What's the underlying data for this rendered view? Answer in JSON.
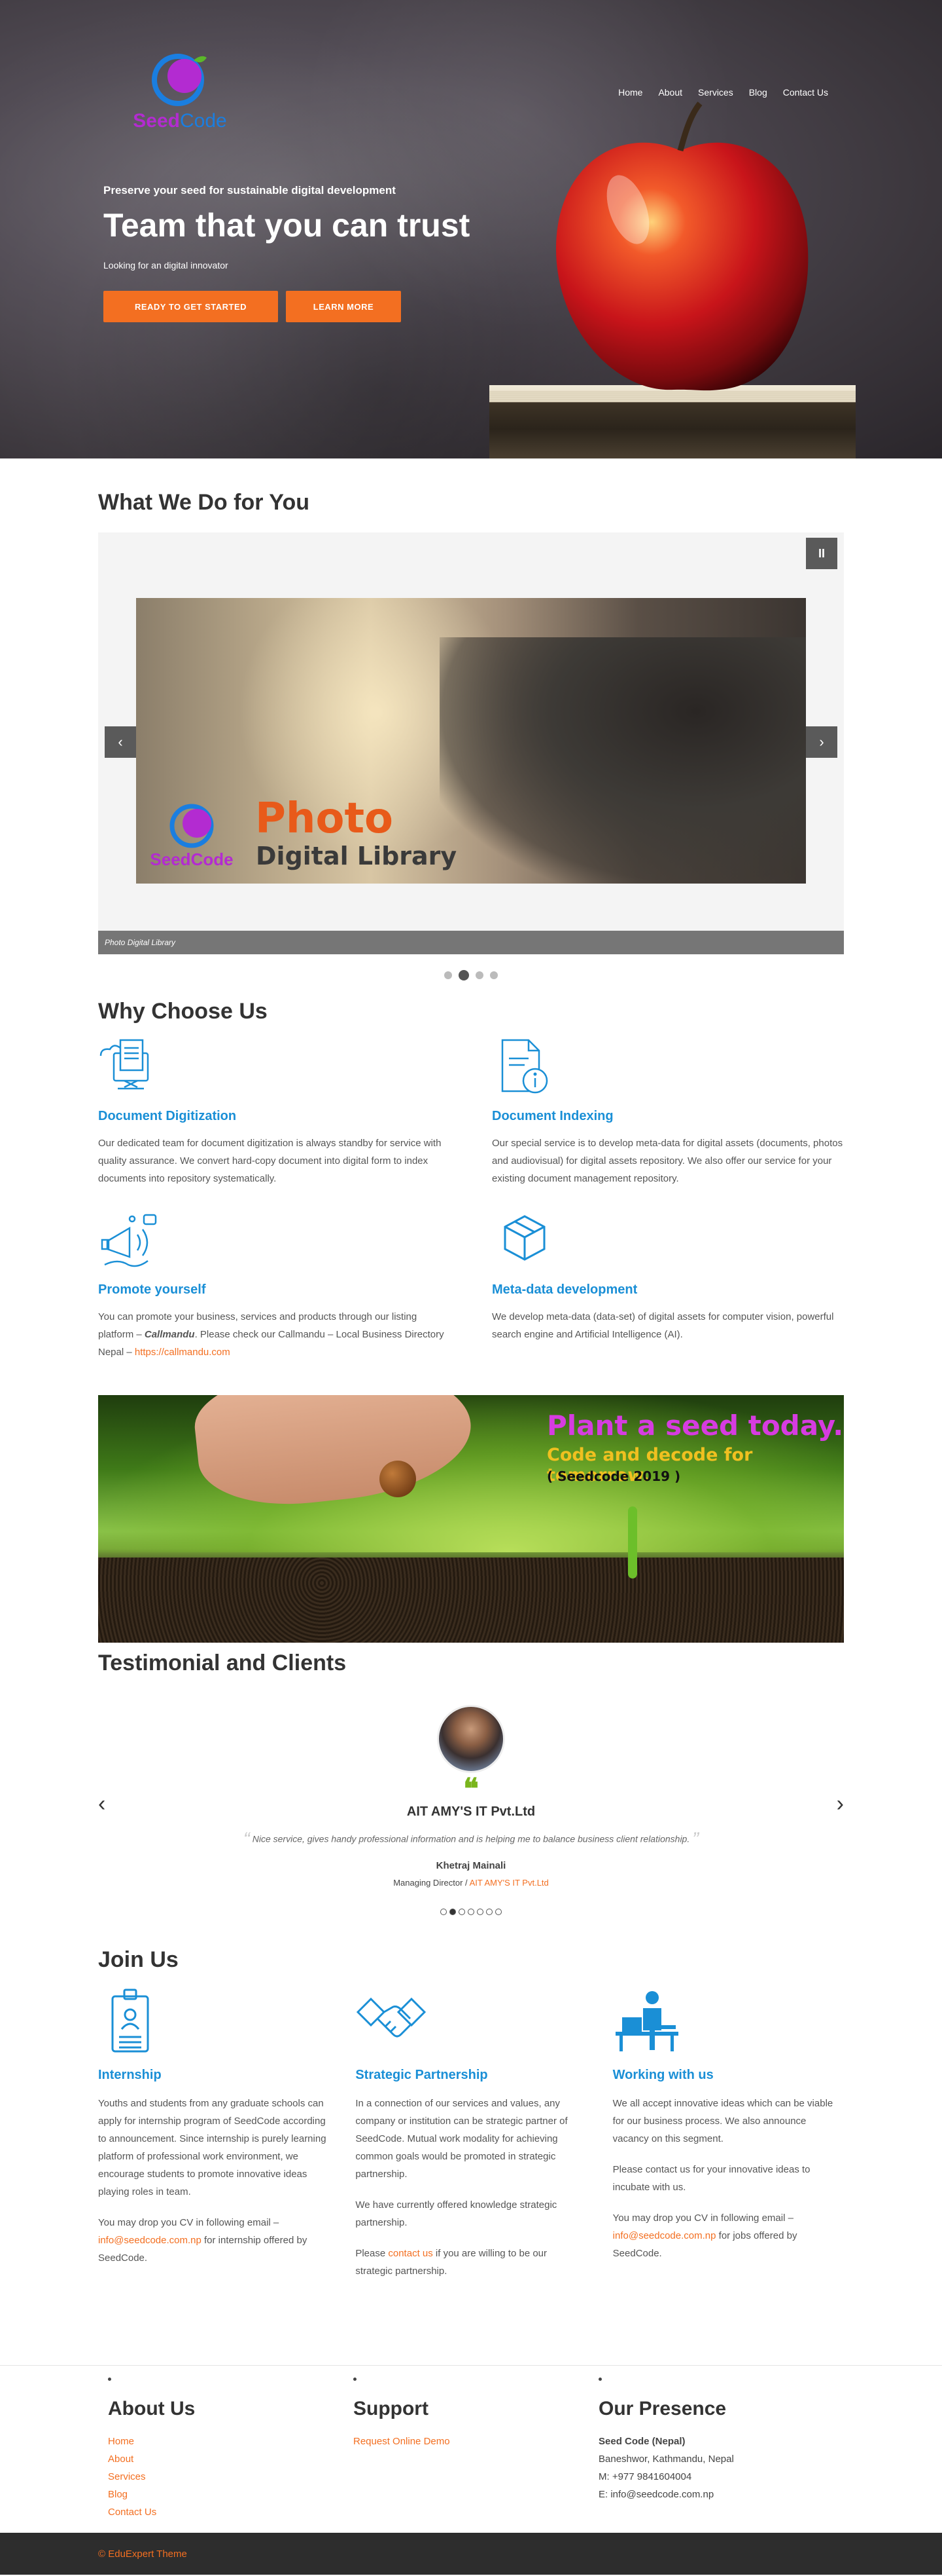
{
  "brand": {
    "logo_text_1": "Seed",
    "logo_text_2": "Code"
  },
  "nav": [
    "Home",
    "About",
    "Services",
    "Blog",
    "Contact Us"
  ],
  "hero": {
    "tagline": "Preserve your seed for sustainable digital development",
    "title": "Team that you can trust",
    "subtitle": "Looking for an digital innovator",
    "btn_primary": "READY TO GET STARTED",
    "btn_secondary": "LEARN MORE"
  },
  "what": {
    "title": "What We Do for You",
    "slide_text_1": "Photo",
    "slide_text_2": "Digital Library",
    "caption": "Photo Digital Library",
    "pause_label": "II",
    "prev_label": "‹",
    "next_label": "›",
    "dots": 4,
    "active_dot": 1
  },
  "why": {
    "title": "Why Choose Us",
    "features": [
      {
        "title": "Document Digitization",
        "text": "Our dedicated team for document digitization is always standby for service with quality assurance. We convert hard-copy document into digital form to index documents into repository systematically."
      },
      {
        "title": "Document Indexing",
        "text": "Our special service is to develop meta-data for digital assets (documents, photos and audiovisual) for digital assets repository. We also offer our service for your existing document management repository."
      },
      {
        "title": "Promote yourself",
        "text_1": "You can promote your business, services and products through our listing platform – ",
        "text_bold": "Callmandu",
        "text_2": ". Please check our Callmandu – Local Business Directory Nepal – ",
        "link": "https://callmandu.com"
      },
      {
        "title": "Meta-data development",
        "text": "We develop meta-data (data-set) of digital assets for computer vision, powerful search engine and Artificial Intelligence (AI)."
      }
    ]
  },
  "banner": {
    "line1": "Plant a seed today.",
    "line2": "Code and decode for tomorrow.",
    "line3": "( Seedcode 2019 )"
  },
  "testimonial": {
    "title": "Testimonial and Clients",
    "quote_mark": "❝",
    "company": "AIT AMY'S IT Pvt.Ltd",
    "quote": "Nice service, gives handy professional information and is helping me to balance business client relationship.",
    "name": "Khetraj Mainali",
    "role": "Managing Director / ",
    "role_link": "AIT AMY'S IT Pvt.Ltd",
    "prev_label": "‹",
    "next_label": "›",
    "dots": 7,
    "active_dot": 1
  },
  "join": {
    "title": "Join Us",
    "cols": [
      {
        "title": "Internship",
        "p1": "Youths and students from any graduate schools can apply for internship program of SeedCode according to announcement. Since internship is purely learning platform of professional work environment, we encourage students to promote innovative ideas playing roles in team.",
        "p2a": "You may drop you CV in following email – ",
        "p2link": "info@seedcode.com.np",
        "p2b": " for internship offered by SeedCode."
      },
      {
        "title": "Strategic Partnership",
        "p1": "In a connection of our services and values, any company or institution can be strategic partner of SeedCode. Mutual work modality for achieving common goals would be promoted in strategic partnership.",
        "p2": "We have currently offered knowledge strategic partnership.",
        "p3a": "Please ",
        "p3link": "contact us",
        "p3b": " if you are willing to be our strategic partnership."
      },
      {
        "title": "Working with us",
        "p1": "We all accept innovative ideas which can be viable for our business process. We also announce vacancy on this segment.",
        "p2": "Please contact us for your innovative ideas to incubate with us.",
        "p3a": "You may drop you CV in following email – ",
        "p3link": "info@seedcode.com.np",
        "p3b": " for jobs offered by SeedCode."
      }
    ]
  },
  "footer": {
    "about_title": "About Us",
    "about_links": [
      "Home",
      "About",
      "Services",
      "Blog",
      "Contact Us"
    ],
    "support_title": "Support",
    "support_links": [
      "Request Online Demo"
    ],
    "presence_title": "Our Presence",
    "presence_lines": [
      "Seed Code (Nepal)",
      "Baneshwor, Kathmandu, Nepal",
      "M: +977 9841604004",
      "E: info@seedcode.com.np"
    ],
    "copyright": "© EduExpert Theme"
  },
  "colors": {
    "accent": "#f36f21",
    "heading_blue": "#1a8fd6",
    "logo_purple": "#b32bd1",
    "quote_green": "#7ab51d"
  },
  "icons": [
    "logo-seed-icon",
    "apple-image",
    "document-digitization-icon",
    "document-indexing-icon",
    "megaphone-icon",
    "cube-icon",
    "id-badge-icon",
    "handshake-icon",
    "person-at-desk-icon"
  ]
}
